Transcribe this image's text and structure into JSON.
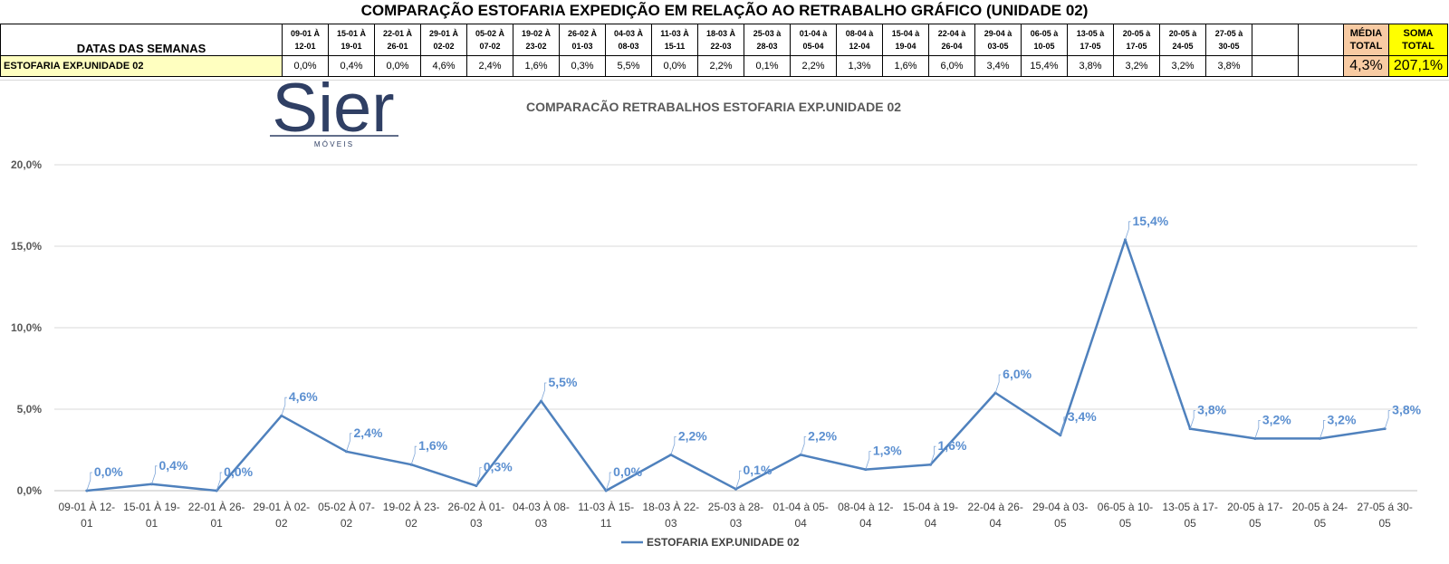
{
  "header": {
    "title": "COMPARAÇÃO ESTOFARIA EXPEDIÇÃO  EM RELAÇÃO AO RETRABALHO GRÁFICO (UNIDADE 02)",
    "dates_label": "DATAS DAS SEMANAS",
    "row_label": "ESTOFARIA EXP.UNIDADE 02",
    "weeks": [
      [
        "09-01 À",
        "12-01"
      ],
      [
        "15-01 À",
        "19-01"
      ],
      [
        "22-01 À",
        "26-01"
      ],
      [
        "29-01 À",
        "02-02"
      ],
      [
        "05-02 À",
        "07-02"
      ],
      [
        "19-02 À",
        "23-02"
      ],
      [
        "26-02 À",
        "01-03"
      ],
      [
        "04-03 À",
        "08-03"
      ],
      [
        "11-03 À",
        "15-11"
      ],
      [
        "18-03 À",
        "22-03"
      ],
      [
        "25-03 à",
        "28-03"
      ],
      [
        "01-04 à",
        "05-04"
      ],
      [
        "08-04 à",
        "12-04"
      ],
      [
        "15-04 à",
        "19-04"
      ],
      [
        "22-04 à",
        "26-04"
      ],
      [
        "29-04 à",
        "03-05"
      ],
      [
        "06-05 à",
        "10-05"
      ],
      [
        "13-05 à",
        "17-05"
      ],
      [
        "20-05 à",
        "17-05"
      ],
      [
        "20-05 à",
        "24-05"
      ],
      [
        "27-05 à",
        "30-05"
      ]
    ],
    "values": [
      "0,0%",
      "0,4%",
      "0,0%",
      "4,6%",
      "2,4%",
      "1,6%",
      "0,3%",
      "5,5%",
      "0,0%",
      "2,2%",
      "0,1%",
      "2,2%",
      "1,3%",
      "1,6%",
      "6,0%",
      "3,4%",
      "15,4%",
      "3,8%",
      "3,2%",
      "3,2%",
      "3,8%"
    ],
    "media_label": [
      "MÉDIA",
      "TOTAL"
    ],
    "media_value": "4,3%",
    "soma_label": [
      "SOMA",
      "TOTAL"
    ],
    "soma_value": "207,1%"
  },
  "logo": {
    "text": "Sier",
    "sub": "M Ó V E I S"
  },
  "chart_data": {
    "type": "line",
    "title": "COMPARACÃO RETRABALHOS  ESTOFARIA EXP.UNIDADE 02",
    "categories": [
      [
        "09-01 À 12-",
        "01"
      ],
      [
        "15-01 À 19-",
        "01"
      ],
      [
        "22-01 À 26-",
        "01"
      ],
      [
        "29-01 À 02-",
        "02"
      ],
      [
        "05-02 À 07-",
        "02"
      ],
      [
        "19-02 À 23-",
        "02"
      ],
      [
        "26-02 À 01-",
        "03"
      ],
      [
        "04-03 À 08-",
        "03"
      ],
      [
        "11-03 À 15-",
        "11"
      ],
      [
        "18-03 À 22-",
        "03"
      ],
      [
        "25-03 à 28-",
        "03"
      ],
      [
        "01-04 à 05-",
        "04"
      ],
      [
        "08-04 à 12-",
        "04"
      ],
      [
        "15-04 à 19-",
        "04"
      ],
      [
        "22-04 à 26-",
        "04"
      ],
      [
        "29-04 à 03-",
        "05"
      ],
      [
        "06-05 à 10-",
        "05"
      ],
      [
        "13-05 à 17-",
        "05"
      ],
      [
        "20-05 à 17-",
        "05"
      ],
      [
        "20-05 à 24-",
        "05"
      ],
      [
        "27-05 á 30-",
        "05"
      ]
    ],
    "series": [
      {
        "name": "ESTOFARIA EXP.UNIDADE 02",
        "values": [
          0.0,
          0.4,
          0.0,
          4.6,
          2.4,
          1.6,
          0.3,
          5.5,
          0.0,
          2.2,
          0.1,
          2.2,
          1.3,
          1.6,
          6.0,
          3.4,
          15.4,
          3.8,
          3.2,
          3.2,
          3.8
        ],
        "labels": [
          "0,0%",
          "0,4%",
          "0,0%",
          "4,6%",
          "2,4%",
          "1,6%",
          "0,3%",
          "5,5%",
          "0,0%",
          "2,2%",
          "0,1%",
          "2,2%",
          "1,3%",
          "1,6%",
          "6,0%",
          "3,4%",
          "15,4%",
          "3,8%",
          "3,2%",
          "3,2%",
          "3,8%"
        ],
        "color": "#4f81bd"
      }
    ],
    "ylim": [
      0,
      20
    ],
    "yticks": [
      0,
      5,
      10,
      15,
      20
    ],
    "ytick_labels": [
      "0,0%",
      "5,0%",
      "10,0%",
      "15,0%",
      "20,0%"
    ],
    "grid": true,
    "legend_position": "bottom",
    "label_color": "#5b8fd0"
  }
}
